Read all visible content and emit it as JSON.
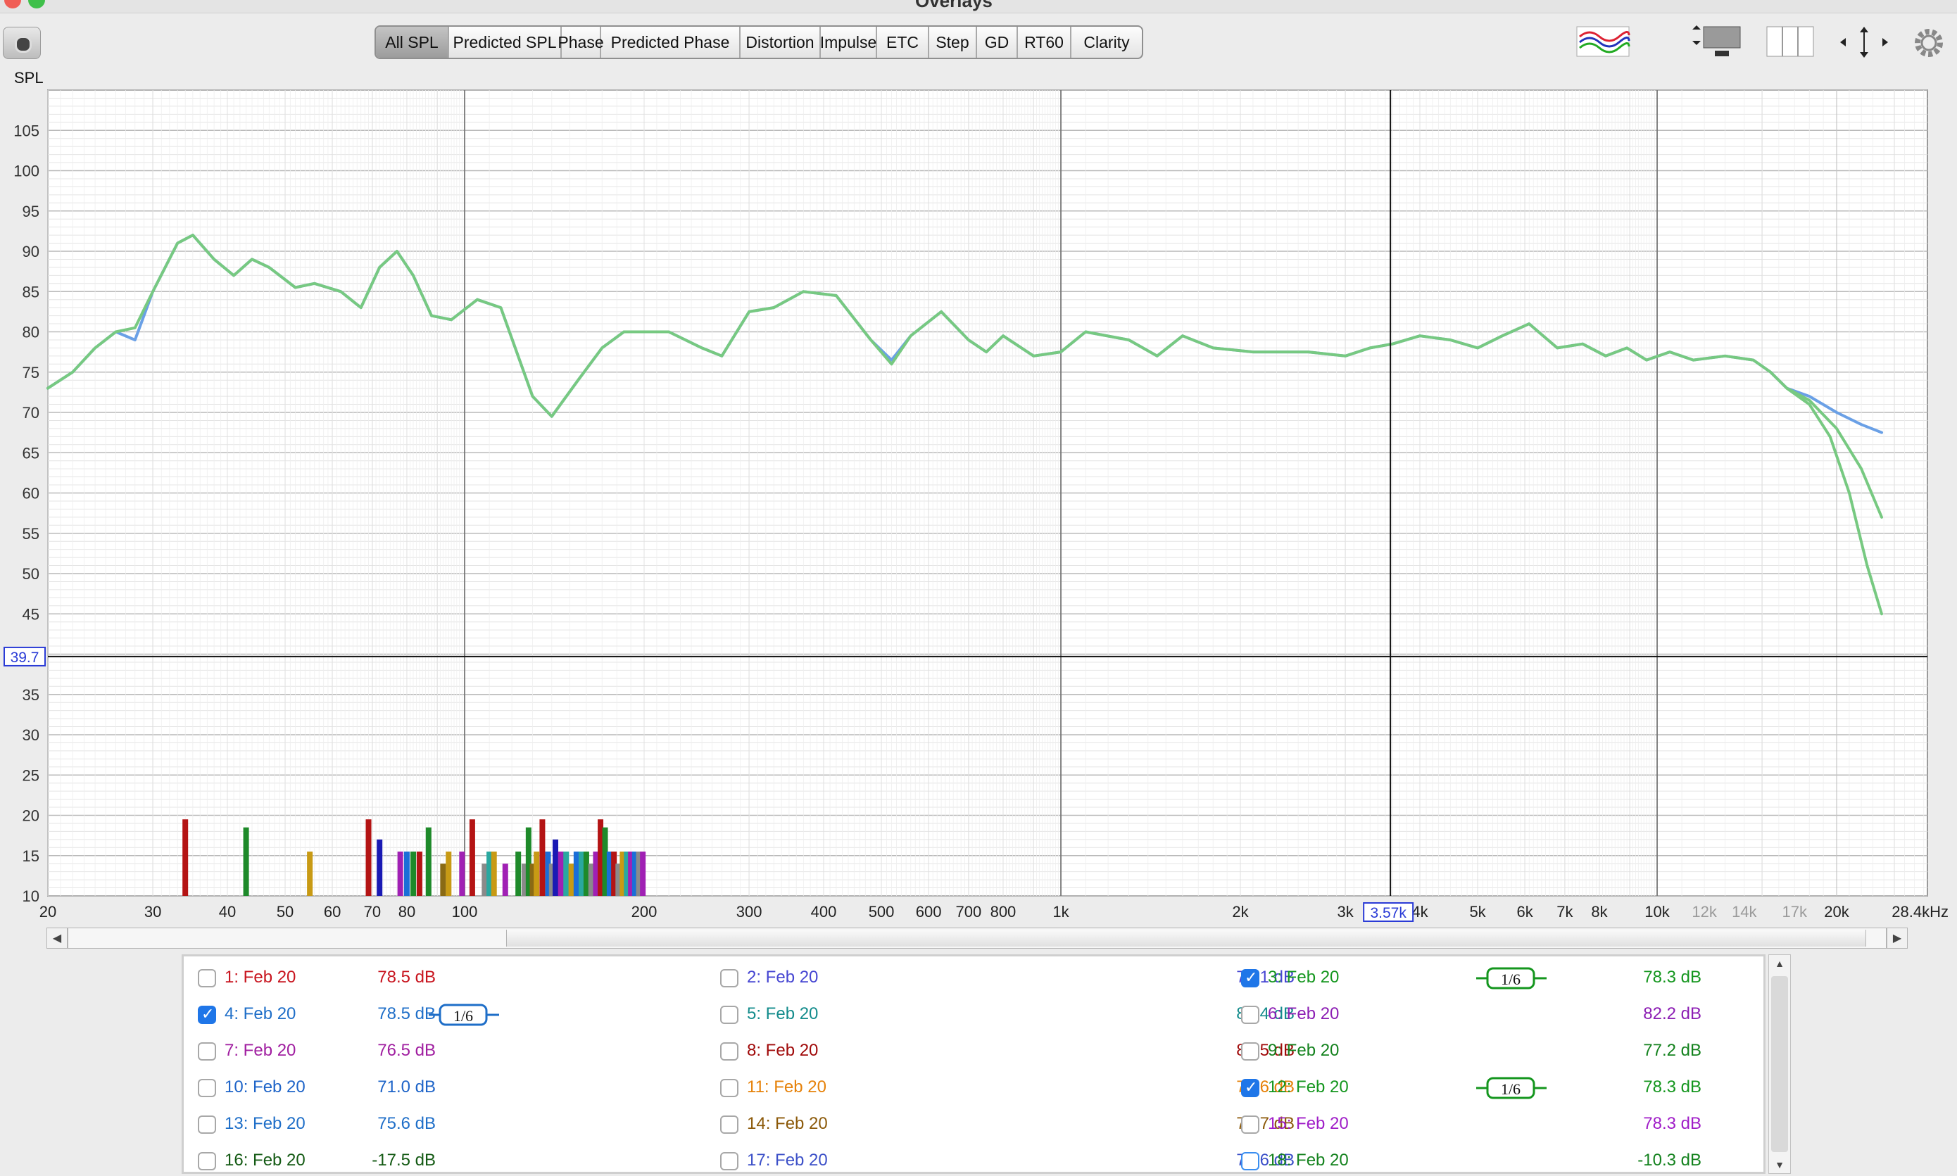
{
  "window": {
    "title": "Overlays"
  },
  "tabs": [
    {
      "label": "All SPL",
      "active": true
    },
    {
      "label": "Predicted SPL"
    },
    {
      "label": "Phase"
    },
    {
      "label": "Predicted Phase"
    },
    {
      "label": "Distortion"
    },
    {
      "label": "Impulse"
    },
    {
      "label": "ETC"
    },
    {
      "label": "Step"
    },
    {
      "label": "GD"
    },
    {
      "label": "RT60"
    },
    {
      "label": "Clarity"
    }
  ],
  "toolbar_icons": [
    "camera-icon",
    "overlay-traces-icon",
    "graph-window-icon",
    "panels-icon",
    "zoom-arrows-icon",
    "gear-icon"
  ],
  "graph": {
    "y_axis_label": "SPL",
    "y_ticks": [
      "105",
      "100",
      "95",
      "90",
      "85",
      "80",
      "75",
      "70",
      "65",
      "60",
      "55",
      "50",
      "45",
      "35",
      "30",
      "25",
      "20",
      "15",
      "10"
    ],
    "x_ticks": [
      {
        "f": 20,
        "label": "20"
      },
      {
        "f": 30,
        "label": "30"
      },
      {
        "f": 40,
        "label": "40"
      },
      {
        "f": 50,
        "label": "50"
      },
      {
        "f": 60,
        "label": "60"
      },
      {
        "f": 70,
        "label": "70"
      },
      {
        "f": 80,
        "label": "80"
      },
      {
        "f": 100,
        "label": "100"
      },
      {
        "f": 200,
        "label": "200"
      },
      {
        "f": 300,
        "label": "300"
      },
      {
        "f": 400,
        "label": "400"
      },
      {
        "f": 500,
        "label": "500"
      },
      {
        "f": 600,
        "label": "600"
      },
      {
        "f": 700,
        "label": "700"
      },
      {
        "f": 800,
        "label": "800"
      },
      {
        "f": 1000,
        "label": "1k"
      },
      {
        "f": 2000,
        "label": "2k"
      },
      {
        "f": 3000,
        "label": "3k"
      },
      {
        "f": 4000,
        "label": "4k"
      },
      {
        "f": 5000,
        "label": "5k"
      },
      {
        "f": 6000,
        "label": "6k"
      },
      {
        "f": 7000,
        "label": "7k"
      },
      {
        "f": 8000,
        "label": "8k"
      },
      {
        "f": 10000,
        "label": "10k"
      },
      {
        "f": 12000,
        "label": "12k",
        "faded": true
      },
      {
        "f": 14000,
        "label": "14k",
        "faded": true
      },
      {
        "f": 17000,
        "label": "17k",
        "faded": true
      },
      {
        "f": 20000,
        "label": "20k"
      }
    ],
    "x_end_label": "28.4kHz",
    "cursor": {
      "freq_label": "3.57k",
      "level_label": "39.7",
      "freq": 3570,
      "level": 39.7
    },
    "colors": {
      "blue": "#6aa0e6",
      "green": "#77c981",
      "cursor_box": "#2a3bd6"
    }
  },
  "chart_data": {
    "type": "line",
    "x_scale": "log",
    "xlim": [
      20,
      28400
    ],
    "ylim": [
      10,
      110
    ],
    "series": [
      {
        "color": "#6aa0e6",
        "points": [
          [
            20,
            73
          ],
          [
            22,
            75
          ],
          [
            24,
            78
          ],
          [
            26,
            80
          ],
          [
            28,
            79
          ],
          [
            30,
            85
          ],
          [
            33,
            91
          ],
          [
            35,
            92
          ],
          [
            38,
            89
          ],
          [
            41,
            87
          ],
          [
            44,
            89
          ],
          [
            47,
            88
          ],
          [
            52,
            85.5
          ],
          [
            56,
            86
          ],
          [
            62,
            85
          ],
          [
            67,
            83
          ],
          [
            72,
            88
          ],
          [
            77,
            90
          ],
          [
            82,
            87
          ],
          [
            88,
            82
          ],
          [
            95,
            81.5
          ],
          [
            105,
            84
          ],
          [
            115,
            83
          ],
          [
            130,
            72
          ],
          [
            140,
            69.5
          ],
          [
            155,
            74
          ],
          [
            170,
            78
          ],
          [
            185,
            80
          ],
          [
            220,
            80
          ],
          [
            250,
            78
          ],
          [
            270,
            77
          ],
          [
            300,
            82.5
          ],
          [
            330,
            83
          ],
          [
            370,
            85
          ],
          [
            420,
            84.5
          ],
          [
            480,
            79
          ],
          [
            520,
            76.5
          ],
          [
            560,
            79.5
          ],
          [
            630,
            82.5
          ],
          [
            700,
            79
          ],
          [
            750,
            77.5
          ],
          [
            800,
            79.5
          ],
          [
            900,
            77
          ],
          [
            1000,
            77.5
          ],
          [
            1100,
            80
          ],
          [
            1300,
            79
          ],
          [
            1450,
            77
          ],
          [
            1600,
            79.5
          ],
          [
            1800,
            78
          ],
          [
            2100,
            77.5
          ],
          [
            2600,
            77.5
          ],
          [
            3000,
            77
          ],
          [
            3300,
            78
          ],
          [
            3600,
            78.5
          ],
          [
            4000,
            79.5
          ],
          [
            4500,
            79
          ],
          [
            5000,
            78
          ],
          [
            5500,
            79.5
          ],
          [
            6100,
            81
          ],
          [
            6800,
            78
          ],
          [
            7500,
            78.5
          ],
          [
            8200,
            77
          ],
          [
            8900,
            78
          ],
          [
            9600,
            76.5
          ],
          [
            10500,
            77.5
          ],
          [
            11500,
            76.5
          ],
          [
            13000,
            77
          ],
          [
            14500,
            76.5
          ],
          [
            15500,
            75
          ],
          [
            16500,
            73
          ],
          [
            18000,
            72
          ],
          [
            20000,
            70
          ],
          [
            22000,
            68.5
          ],
          [
            23800,
            67.5
          ]
        ]
      },
      {
        "color": "#77c981",
        "points": [
          [
            20,
            73
          ],
          [
            22,
            75
          ],
          [
            24,
            78
          ],
          [
            26,
            80
          ],
          [
            28,
            80.5
          ],
          [
            30,
            85
          ],
          [
            33,
            91
          ],
          [
            35,
            92
          ],
          [
            38,
            89
          ],
          [
            41,
            87
          ],
          [
            44,
            89
          ],
          [
            47,
            88
          ],
          [
            52,
            85.5
          ],
          [
            56,
            86
          ],
          [
            62,
            85
          ],
          [
            67,
            83
          ],
          [
            72,
            88
          ],
          [
            77,
            90
          ],
          [
            82,
            87
          ],
          [
            88,
            82
          ],
          [
            95,
            81.5
          ],
          [
            105,
            84
          ],
          [
            115,
            83
          ],
          [
            130,
            72
          ],
          [
            140,
            69.5
          ],
          [
            155,
            74
          ],
          [
            170,
            78
          ],
          [
            185,
            80
          ],
          [
            220,
            80
          ],
          [
            250,
            78
          ],
          [
            270,
            77
          ],
          [
            300,
            82.5
          ],
          [
            330,
            83
          ],
          [
            370,
            85
          ],
          [
            420,
            84.5
          ],
          [
            480,
            79
          ],
          [
            520,
            76
          ],
          [
            560,
            79.5
          ],
          [
            630,
            82.5
          ],
          [
            700,
            79
          ],
          [
            750,
            77.5
          ],
          [
            800,
            79.5
          ],
          [
            900,
            77
          ],
          [
            1000,
            77.5
          ],
          [
            1100,
            80
          ],
          [
            1300,
            79
          ],
          [
            1450,
            77
          ],
          [
            1600,
            79.5
          ],
          [
            1800,
            78
          ],
          [
            2100,
            77.5
          ],
          [
            2600,
            77.5
          ],
          [
            3000,
            77
          ],
          [
            3300,
            78
          ],
          [
            3600,
            78.5
          ],
          [
            4000,
            79.5
          ],
          [
            4500,
            79
          ],
          [
            5000,
            78
          ],
          [
            5500,
            79.5
          ],
          [
            6100,
            81
          ],
          [
            6800,
            78
          ],
          [
            7500,
            78.5
          ],
          [
            8200,
            77
          ],
          [
            8900,
            78
          ],
          [
            9600,
            76.5
          ],
          [
            10500,
            77.5
          ],
          [
            11500,
            76.5
          ],
          [
            13000,
            77
          ],
          [
            14500,
            76.5
          ],
          [
            15500,
            75
          ],
          [
            16500,
            73
          ],
          [
            18000,
            71.5
          ],
          [
            20000,
            68
          ],
          [
            22000,
            63
          ],
          [
            23800,
            57
          ]
        ]
      },
      {
        "color": "#77c981",
        "points": [
          [
            16500,
            73
          ],
          [
            18000,
            71
          ],
          [
            19500,
            67
          ],
          [
            21000,
            60
          ],
          [
            22500,
            51
          ],
          [
            23800,
            45
          ]
        ]
      }
    ],
    "bars": [
      {
        "f": 34,
        "h": 19.5,
        "c": "#b41414"
      },
      {
        "f": 43,
        "h": 18.5,
        "c": "#1e8a2a"
      },
      {
        "f": 55,
        "h": 15.5,
        "c": "#c89a14"
      },
      {
        "f": 69,
        "h": 19.5,
        "c": "#b41414"
      },
      {
        "f": 72,
        "h": 17,
        "c": "#1a1ab4"
      },
      {
        "f": 78,
        "h": 15.5,
        "c": "#a020b4"
      },
      {
        "f": 80,
        "h": 15.5,
        "c": "#1a6ed8"
      },
      {
        "f": 82,
        "h": 15.5,
        "c": "#1e8a2a"
      },
      {
        "f": 84,
        "h": 15.5,
        "c": "#b41414"
      },
      {
        "f": 87,
        "h": 18.5,
        "c": "#1e8a2a"
      },
      {
        "f": 92,
        "h": 14,
        "c": "#8a6a14"
      },
      {
        "f": 94,
        "h": 15.5,
        "c": "#c89a14"
      },
      {
        "f": 99,
        "h": 15.5,
        "c": "#a020b4"
      },
      {
        "f": 103,
        "h": 19.5,
        "c": "#b41414"
      },
      {
        "f": 108,
        "h": 14,
        "c": "#8a8a8a"
      },
      {
        "f": 110,
        "h": 15.5,
        "c": "#2aa8a0"
      },
      {
        "f": 112,
        "h": 15.5,
        "c": "#c89a14"
      },
      {
        "f": 117,
        "h": 14,
        "c": "#a020b4"
      },
      {
        "f": 123,
        "h": 15.5,
        "c": "#1e8a2a"
      },
      {
        "f": 126,
        "h": 14,
        "c": "#8a8a8a"
      },
      {
        "f": 128,
        "h": 18.5,
        "c": "#1e8a2a"
      },
      {
        "f": 130,
        "h": 14,
        "c": "#8a6a14"
      },
      {
        "f": 132,
        "h": 15.5,
        "c": "#c89a14"
      },
      {
        "f": 135,
        "h": 19.5,
        "c": "#b41414"
      },
      {
        "f": 138,
        "h": 15.5,
        "c": "#1a6ed8"
      },
      {
        "f": 140,
        "h": 14,
        "c": "#8a8a8a"
      },
      {
        "f": 142,
        "h": 17,
        "c": "#1a1ab4"
      },
      {
        "f": 145,
        "h": 15.5,
        "c": "#a020b4"
      },
      {
        "f": 148,
        "h": 15.5,
        "c": "#2aa8a0"
      },
      {
        "f": 151,
        "h": 14,
        "c": "#c89a14"
      },
      {
        "f": 154,
        "h": 15.5,
        "c": "#1a6ed8"
      },
      {
        "f": 157,
        "h": 15.5,
        "c": "#2aa8a0"
      },
      {
        "f": 160,
        "h": 15.5,
        "c": "#1e8a2a"
      },
      {
        "f": 163,
        "h": 14,
        "c": "#8a8a8a"
      },
      {
        "f": 166,
        "h": 15.5,
        "c": "#a020b4"
      },
      {
        "f": 169,
        "h": 19.5,
        "c": "#b41414"
      },
      {
        "f": 172,
        "h": 18.5,
        "c": "#1e8a2a"
      },
      {
        "f": 175,
        "h": 15.5,
        "c": "#1a6ed8"
      },
      {
        "f": 178,
        "h": 15.5,
        "c": "#b41414"
      },
      {
        "f": 181,
        "h": 14,
        "c": "#8a8a8a"
      },
      {
        "f": 184,
        "h": 15.5,
        "c": "#c89a14"
      },
      {
        "f": 187,
        "h": 15.5,
        "c": "#2aa8a0"
      },
      {
        "f": 190,
        "h": 15.5,
        "c": "#a020b4"
      },
      {
        "f": 193,
        "h": 15.5,
        "c": "#1a6ed8"
      },
      {
        "f": 196,
        "h": 15.5,
        "c": "#8a8a8a"
      },
      {
        "f": 199,
        "h": 15.5,
        "c": "#a020b4"
      }
    ]
  },
  "measurements": [
    {
      "name": "1: Feb 20",
      "value": "78.5 dB",
      "checked": false,
      "color": "#c8141e"
    },
    {
      "name": "2: Feb 20",
      "value": "71.1 dB",
      "checked": false,
      "color": "#4646d2"
    },
    {
      "name": "3: Feb 20",
      "value": "78.3 dB",
      "checked": true,
      "color": "#14961e",
      "smoothing": "1/6"
    },
    {
      "name": "4: Feb 20",
      "value": "78.5 dB",
      "checked": true,
      "color": "#1e6ec8",
      "smoothing": "1/6"
    },
    {
      "name": "5: Feb 20",
      "value": "82.4 dB",
      "checked": false,
      "color": "#148c8c"
    },
    {
      "name": "6: Feb 20",
      "value": "82.2 dB",
      "checked": false,
      "color": "#8c1eb4"
    },
    {
      "name": "7: Feb 20",
      "value": "76.5 dB",
      "checked": false,
      "color": "#a01ea0"
    },
    {
      "name": "8: Feb 20",
      "value": "82.5 dB",
      "checked": false,
      "color": "#a00a0a"
    },
    {
      "name": "9: Feb 20",
      "value": "77.2 dB",
      "checked": false,
      "color": "#14821e"
    },
    {
      "name": "10: Feb 20",
      "value": "71.0 dB",
      "checked": false,
      "color": "#1e64c8"
    },
    {
      "name": "11: Feb 20",
      "value": "75.6 dB",
      "checked": false,
      "color": "#e6820a"
    },
    {
      "name": "12: Feb 20",
      "value": "78.3 dB",
      "checked": true,
      "color": "#14961e",
      "smoothing": "1/6"
    },
    {
      "name": "13: Feb 20",
      "value": "75.6 dB",
      "checked": false,
      "color": "#1e6ec8"
    },
    {
      "name": "14: Feb 20",
      "value": "77.7 dB",
      "checked": false,
      "color": "#8c5a0a"
    },
    {
      "name": "15: Feb 20",
      "value": "78.3 dB",
      "checked": false,
      "color": "#a01ec8"
    },
    {
      "name": "16: Feb 20",
      "value": "-17.5 dB",
      "checked": false,
      "color": "#145a14"
    },
    {
      "name": "17: Feb 20",
      "value": "77.6 dB",
      "checked": false,
      "color": "#3c50c8"
    },
    {
      "name": "18: Feb 20",
      "value": "-10.3 dB",
      "checked": false,
      "color": "#14821e",
      "focus": true
    }
  ]
}
